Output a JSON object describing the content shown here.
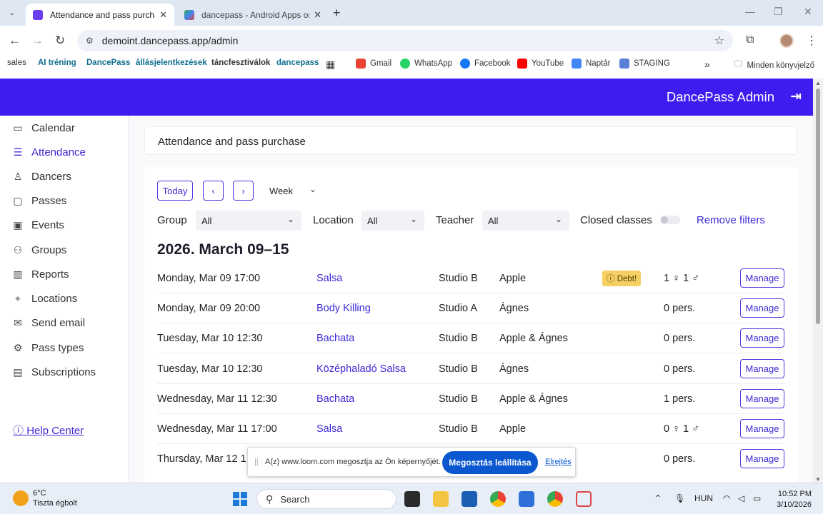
{
  "browser": {
    "tabs": [
      {
        "title": "Attendance and pass purchase |",
        "active": true
      },
      {
        "title": "dancepass - Android Apps on G",
        "active": false
      }
    ],
    "url": "demoint.dancepass.app/admin",
    "bookmarks": [
      "sales",
      "AI tréning",
      "DancePass",
      "állásjelentkezések",
      "táncfesztiválok",
      "dancepass",
      "Gmail",
      "WhatsApp",
      "Facebook",
      "YouTube",
      "Naptár",
      "STAGING"
    ],
    "all_bookmarks": "Minden könyvjelző"
  },
  "header": {
    "brand": "DancePass Admin"
  },
  "sidebar": {
    "items": [
      {
        "label": "Calendar",
        "icon": "calendar-icon"
      },
      {
        "label": "Attendance",
        "icon": "list-icon",
        "active": true
      },
      {
        "label": "Dancers",
        "icon": "person-icon"
      },
      {
        "label": "Passes",
        "icon": "ticket-icon"
      },
      {
        "label": "Events",
        "icon": "event-icon"
      },
      {
        "label": "Groups",
        "icon": "group-icon"
      },
      {
        "label": "Reports",
        "icon": "bar-chart-icon"
      },
      {
        "label": "Locations",
        "icon": "pin-icon"
      },
      {
        "label": "Send email",
        "icon": "mail-icon"
      },
      {
        "label": "Pass types",
        "icon": "gear-icon"
      },
      {
        "label": "Subscriptions",
        "icon": "card-icon"
      }
    ],
    "help": "Help Center"
  },
  "page": {
    "title": "Attendance and pass purchase",
    "today": "Today",
    "view": "Week",
    "filters": {
      "group_label": "Group",
      "group_value": "All",
      "location_label": "Location",
      "location_value": "All",
      "teacher_label": "Teacher",
      "teacher_value": "All",
      "closed_label": "Closed classes",
      "remove": "Remove filters"
    },
    "week_heading": "2026. March 09–15",
    "rows": [
      {
        "date": "Monday, Mar 09 17:00",
        "class": "Salsa",
        "studio": "Studio B",
        "teacher": "Apple",
        "debt": "Debt!",
        "count": "1 ♀  1 ♂",
        "manage": "Manage"
      },
      {
        "date": "Monday, Mar 09 20:00",
        "class": "Body Killing",
        "studio": "Studio A",
        "teacher": "Ágnes",
        "debt": "",
        "count": "0 pers.",
        "manage": "Manage"
      },
      {
        "date": "Tuesday, Mar 10 12:30",
        "class": "Bachata",
        "studio": "Studio B",
        "teacher": "Apple & Ágnes",
        "debt": "",
        "count": "0 pers.",
        "manage": "Manage"
      },
      {
        "date": "Tuesday, Mar 10 12:30",
        "class": "Középhaladó Salsa",
        "studio": "Studio B",
        "teacher": "Ágnes",
        "debt": "",
        "count": "0 pers.",
        "manage": "Manage"
      },
      {
        "date": "Wednesday, Mar 11 12:30",
        "class": "Bachata",
        "studio": "Studio B",
        "teacher": "Apple & Ágnes",
        "debt": "",
        "count": "1 pers.",
        "manage": "Manage"
      },
      {
        "date": "Wednesday, Mar 11 17:00",
        "class": "Salsa",
        "studio": "Studio B",
        "teacher": "Apple",
        "debt": "",
        "count": "0 ♀  1 ♂",
        "manage": "Manage"
      },
      {
        "date": "Thursday, Mar 12 1:",
        "class": "",
        "studio": "",
        "teacher": "",
        "debt": "",
        "count": "0 pers.",
        "manage": "Manage"
      }
    ]
  },
  "loom": {
    "message": "A(z) www.loom.com megosztja az Ön képernyőjét.",
    "stop": "Megosztás leállítása",
    "hide": "Elrejtés"
  },
  "taskbar": {
    "temp": "6°C",
    "weather": "Tiszta égbolt",
    "search": "Search",
    "lang": "HUN",
    "time": "10:52 PM",
    "date": "3/10/2026"
  }
}
